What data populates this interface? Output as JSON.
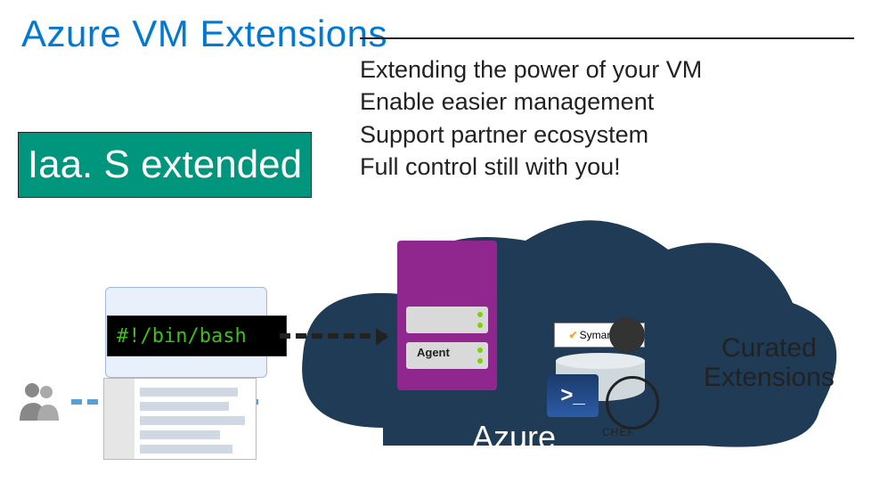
{
  "title": "Azure VM Extensions",
  "iaas_badge": "Iaa. S extended",
  "bullets": {
    "b1": "Extending the power of your VM",
    "b2": "Enable easier management",
    "b3": "Support partner ecosystem",
    "b4": "Full control still with you!"
  },
  "bash_text": "#!/bin/bash",
  "agent_label": "Agent",
  "azure_label": "Azure",
  "curated_line1": "Curated",
  "curated_line2": "Extensions",
  "symantec": "Symantec.",
  "ps_label": ">_",
  "chef_label": "CHEF"
}
